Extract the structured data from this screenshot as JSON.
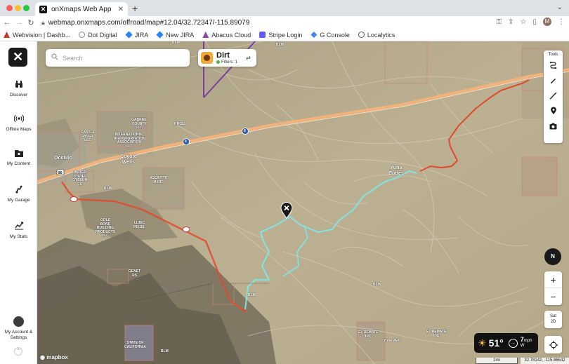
{
  "browser": {
    "tab_title": "onXmaps Web App",
    "url": "webmap.onxmaps.com/offroad/map#12.04/32.72347/-115.89079",
    "profile_initial": "M",
    "bookmarks": [
      {
        "label": "Webvision | Dashb...",
        "color": "#c0392b"
      },
      {
        "label": "Dot Digital",
        "color": "#888888"
      },
      {
        "label": "JIRA",
        "color": "#2684ff"
      },
      {
        "label": "New JIRA",
        "color": "#2684ff"
      },
      {
        "label": "Abacus Cloud",
        "color": "#8e44ad"
      },
      {
        "label": "Stripe Login",
        "color": "#635bff"
      },
      {
        "label": "G Console",
        "color": "#4285f4"
      },
      {
        "label": "Localytics",
        "color": "#555555"
      }
    ]
  },
  "sidebar": {
    "logo": "✕",
    "items": [
      {
        "label": "Discover",
        "icon": "binoculars-icon"
      },
      {
        "label": "Offline Maps",
        "icon": "offline-signal-icon"
      },
      {
        "label": "My Content",
        "icon": "folder-icon"
      },
      {
        "label": "My Garage",
        "icon": "vehicle-icon"
      },
      {
        "label": "My Stats",
        "icon": "stats-icon"
      }
    ],
    "account_label": "My Account & Settings"
  },
  "map": {
    "search_placeholder": "Search",
    "layer": {
      "name": "Dirt",
      "filters": "Filters: 1"
    },
    "tools_label": "Tools",
    "compass": "N",
    "zoom_in": "+",
    "zoom_out": "−",
    "basemap": {
      "line1": "Sat",
      "line2": "2D"
    },
    "weather": {
      "temp": "51°",
      "wind_speed": "7",
      "wind_unit": "mph",
      "wind_dir": "W"
    },
    "scale": "1mi",
    "coords": "32.78142, -115.86642",
    "attribution": "mapbox",
    "labels": [
      "BLM",
      "BLM",
      "BLM",
      "BLM",
      "BLM",
      "BLM",
      "GABRIEL\nCOUNTY\nLLC",
      "INTERNATIONAL\nTRANSPORTATION\nASSOCIATION\nLLC",
      "KROLL",
      "CASTLE\nRIVER\nLLC",
      "Ocotillo",
      "Coyote\nWells",
      "UNITED\nSTATES\nGYPSUM\nCO",
      "ASCIUTTO\nMARC",
      "GOLD\nBOND\nBUILDING\nPRODUCTS\nLLC",
      "LUBIC\nPEGEL",
      "GENET\nRS",
      "STATE OF\nCALIFORNIA",
      "Yuha\nButtes",
      "EL REMATE\nINC",
      "EL REMATE\nINC",
      "Yuha Well",
      "80",
      "8",
      "8"
    ],
    "colors": {
      "trail_cyan": "#7fe6e6",
      "route_red": "#e24a2c",
      "highway": "#f2b27a",
      "boundary": "#7b3fa0"
    }
  }
}
